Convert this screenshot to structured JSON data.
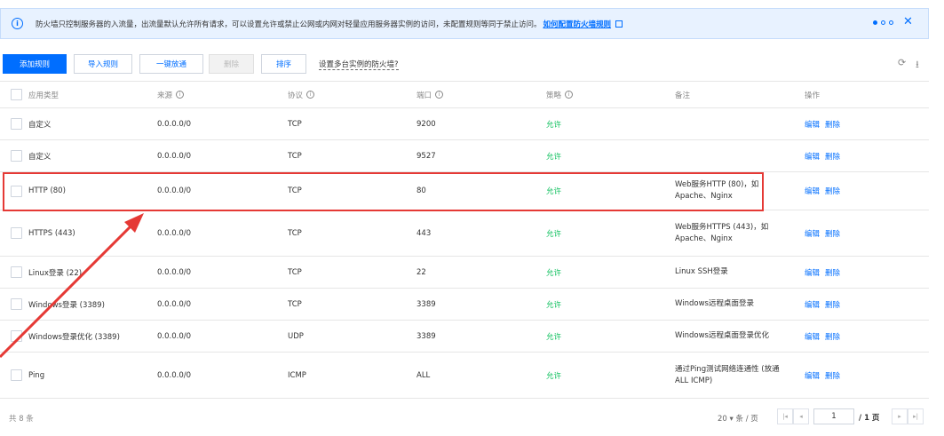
{
  "notice": {
    "text": "防火墙只控制服务器的入流量，出流量默认允许所有请求，可以设置允许或禁止公网或内网对轻量应用服务器实例的访问，未配置规则等同于禁止访问。",
    "link": "如何配置防火墙规则",
    "close": "✕"
  },
  "toolbar": {
    "add": "添加规则",
    "import": "导入规则",
    "oneclick": "一键放通",
    "delete": "删除",
    "sort": "排序",
    "help": "设置多台实例的防火墙?"
  },
  "columns": {
    "type": "应用类型",
    "source": "来源",
    "protocol": "协议",
    "port": "端口",
    "policy": "策略",
    "remark": "备注",
    "ops": "操作"
  },
  "rows": [
    {
      "type": "自定义",
      "source": "0.0.0.0/0",
      "protocol": "TCP",
      "port": "9200",
      "policy": "允许",
      "remark1": "",
      "remark2": "",
      "edit": "编辑",
      "del": "删除"
    },
    {
      "type": "自定义",
      "source": "0.0.0.0/0",
      "protocol": "TCP",
      "port": "9527",
      "policy": "允许",
      "remark1": "",
      "remark2": "",
      "edit": "编辑",
      "del": "删除"
    },
    {
      "type": "HTTP (80)",
      "source": "0.0.0.0/0",
      "protocol": "TCP",
      "port": "80",
      "policy": "允许",
      "remark1": "Web服务HTTP (80)，如",
      "remark2": "Apache、Nginx",
      "edit": "编辑",
      "del": "删除"
    },
    {
      "type": "HTTPS (443)",
      "source": "0.0.0.0/0",
      "protocol": "TCP",
      "port": "443",
      "policy": "允许",
      "remark1": "Web服务HTTPS (443)，如",
      "remark2": "Apache、Nginx",
      "edit": "编辑",
      "del": "删除"
    },
    {
      "type": "Linux登录 (22)",
      "source": "0.0.0.0/0",
      "protocol": "TCP",
      "port": "22",
      "policy": "允许",
      "remark1": "Linux SSH登录",
      "remark2": "",
      "edit": "编辑",
      "del": "删除"
    },
    {
      "type": "Windows登录 (3389)",
      "source": "0.0.0.0/0",
      "protocol": "TCP",
      "port": "3389",
      "policy": "允许",
      "remark1": "Windows远程桌面登录",
      "remark2": "",
      "edit": "编辑",
      "del": "删除"
    },
    {
      "type": "Windows登录优化 (3389)",
      "source": "0.0.0.0/0",
      "protocol": "UDP",
      "port": "3389",
      "policy": "允许",
      "remark1": "Windows远程桌面登录优化",
      "remark2": "",
      "edit": "编辑",
      "del": "删除"
    },
    {
      "type": "Ping",
      "source": "0.0.0.0/0",
      "protocol": "ICMP",
      "port": "ALL",
      "policy": "允许",
      "remark1": "通过Ping测试网络连通性 (放通",
      "remark2": "ALL ICMP)",
      "edit": "编辑",
      "del": "删除"
    }
  ],
  "footer": {
    "total": "共 8 条",
    "perpage": "20 ▾ 条 / 页",
    "page": "1",
    "pages": "/ 1 页"
  }
}
